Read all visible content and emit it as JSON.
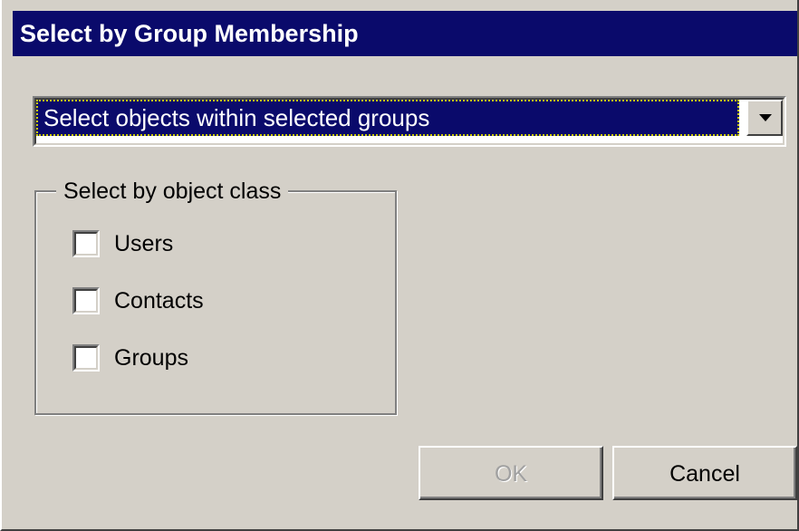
{
  "window": {
    "title": "Select by Group Membership"
  },
  "combo": {
    "selected": "Select objects within selected groups"
  },
  "groupbox": {
    "label": "Select by object class",
    "options": [
      {
        "label": "Users",
        "checked": false
      },
      {
        "label": "Contacts",
        "checked": false
      },
      {
        "label": "Groups",
        "checked": false
      }
    ]
  },
  "buttons": {
    "ok_label": "OK",
    "ok_enabled": false,
    "cancel_label": "Cancel"
  },
  "colors": {
    "title_bar": "#0a0a6b",
    "face": "#d4d0c8",
    "selection": "#0a0a6b",
    "disabled_text": "#a0a0a0"
  },
  "icons": {
    "dropdown": "chevron-down-icon"
  }
}
